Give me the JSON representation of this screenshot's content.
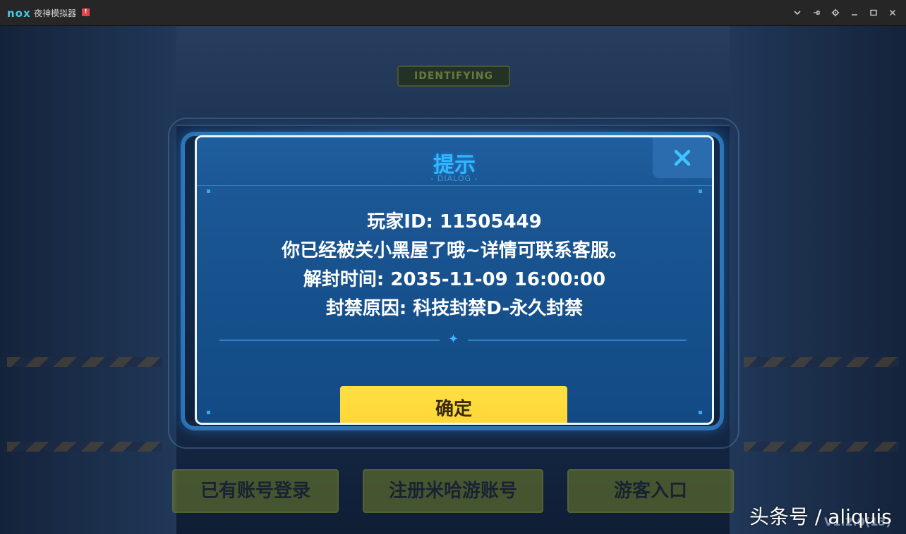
{
  "window": {
    "logo_text": "nox",
    "title": "夜神模拟器",
    "warning_badge": "!"
  },
  "title_controls": [
    "chevron-down-icon",
    "pin-icon",
    "gear-icon",
    "minimize-icon",
    "maximize-icon",
    "close-icon"
  ],
  "scene": {
    "sign_text": "IDENTIFYING",
    "version": "V1.2.0(13)"
  },
  "dialog": {
    "title": "提示",
    "subtitle": "- DIALOG -",
    "lines": [
      "玩家ID: 11505449",
      "你已经被关小黑屋了哦~详情可联系客服。",
      "解封时间: 2035-11-09 16:00:00",
      "封禁原因: 科技封禁D-永久封禁"
    ],
    "confirm_label": "确定"
  },
  "bottom_buttons": {
    "login": "已有账号登录",
    "register": "注册米哈游账号",
    "guest": "游客入口"
  },
  "watermark": "头条号 / aliquis",
  "colors": {
    "accent_cyan": "#2fb8ff",
    "confirm_yellow": "#ffd531",
    "dialog_blue": "#17528e",
    "titlebar": "#262626"
  }
}
